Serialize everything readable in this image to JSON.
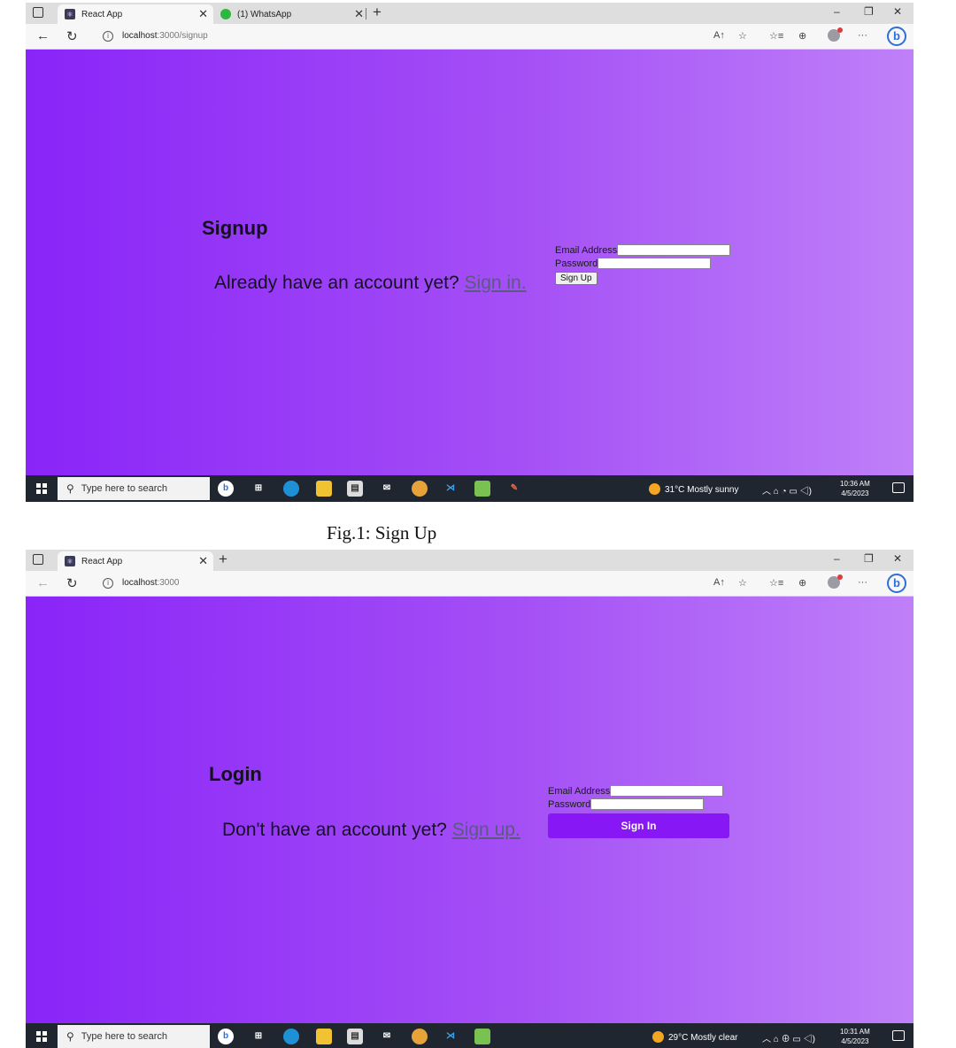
{
  "caption": "Fig.1: Sign Up",
  "signup_screen": {
    "tabs": [
      {
        "title": "React App",
        "favicon": "react-icon"
      },
      {
        "title": "(1) WhatsApp",
        "favicon": "whatsapp-icon"
      }
    ],
    "url_host": "localhost",
    "url_rest": ":3000/signup",
    "heading": "Signup",
    "prompt": "Already have an account yet?",
    "link": "Sign in.",
    "email_label": "Email Address",
    "email_value": "",
    "password_label": "Password",
    "password_value": "",
    "submit_label": "Sign Up",
    "taskbar": {
      "search_placeholder": "Type here to search",
      "weather": "31°C  Mostly sunny",
      "time": "10:36 AM",
      "date": "4/5/2023"
    }
  },
  "login_screen": {
    "tabs": [
      {
        "title": "React App",
        "favicon": "react-icon"
      }
    ],
    "url_host": "localhost",
    "url_rest": ":3000",
    "heading": "Login",
    "prompt": "Don't have an account yet?",
    "link": "Sign up.",
    "email_label": "Email Address",
    "email_value": "",
    "password_label": "Password",
    "password_value": "",
    "submit_label": "Sign In",
    "taskbar": {
      "search_placeholder": "Type here to search",
      "weather": "29°C  Mostly clear",
      "time": "10:31 AM",
      "date": "4/5/2023"
    }
  },
  "colors": {
    "gradient_start": "#8a24f8",
    "gradient_end": "#bf80f8",
    "sign_in_button": "#8817f5",
    "taskbar": "#1f2630"
  }
}
